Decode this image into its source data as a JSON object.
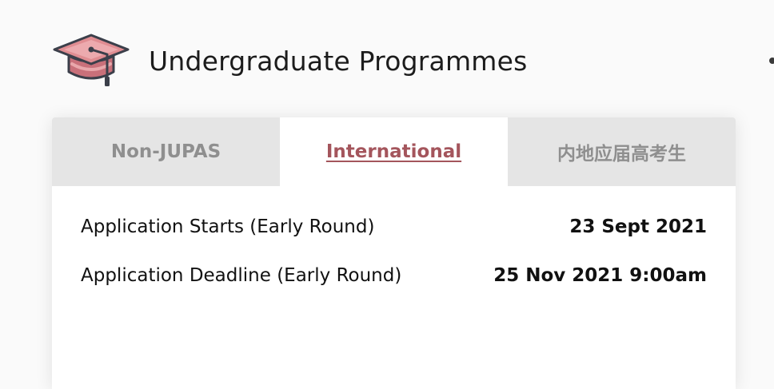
{
  "header": {
    "title": "Undergraduate Programmes",
    "icon": "graduation-cap-icon"
  },
  "tabs": [
    {
      "label": "Non-JUPAS",
      "active": false
    },
    {
      "label": "International",
      "active": true
    },
    {
      "label": "内地应届高考生",
      "active": false
    }
  ],
  "schedule": [
    {
      "label": "Application Starts (Early Round)",
      "value": "23 Sept 2021"
    },
    {
      "label": "Application Deadline (Early Round)",
      "value": "25 Nov 2021 9:00am"
    }
  ],
  "colors": {
    "accent": "#a4555c",
    "tab_inactive_bg": "#e5e5e5",
    "tab_inactive_text": "#8f8f8f",
    "cap_fill": "#d9868a",
    "cap_outline": "#3b3f4a"
  }
}
